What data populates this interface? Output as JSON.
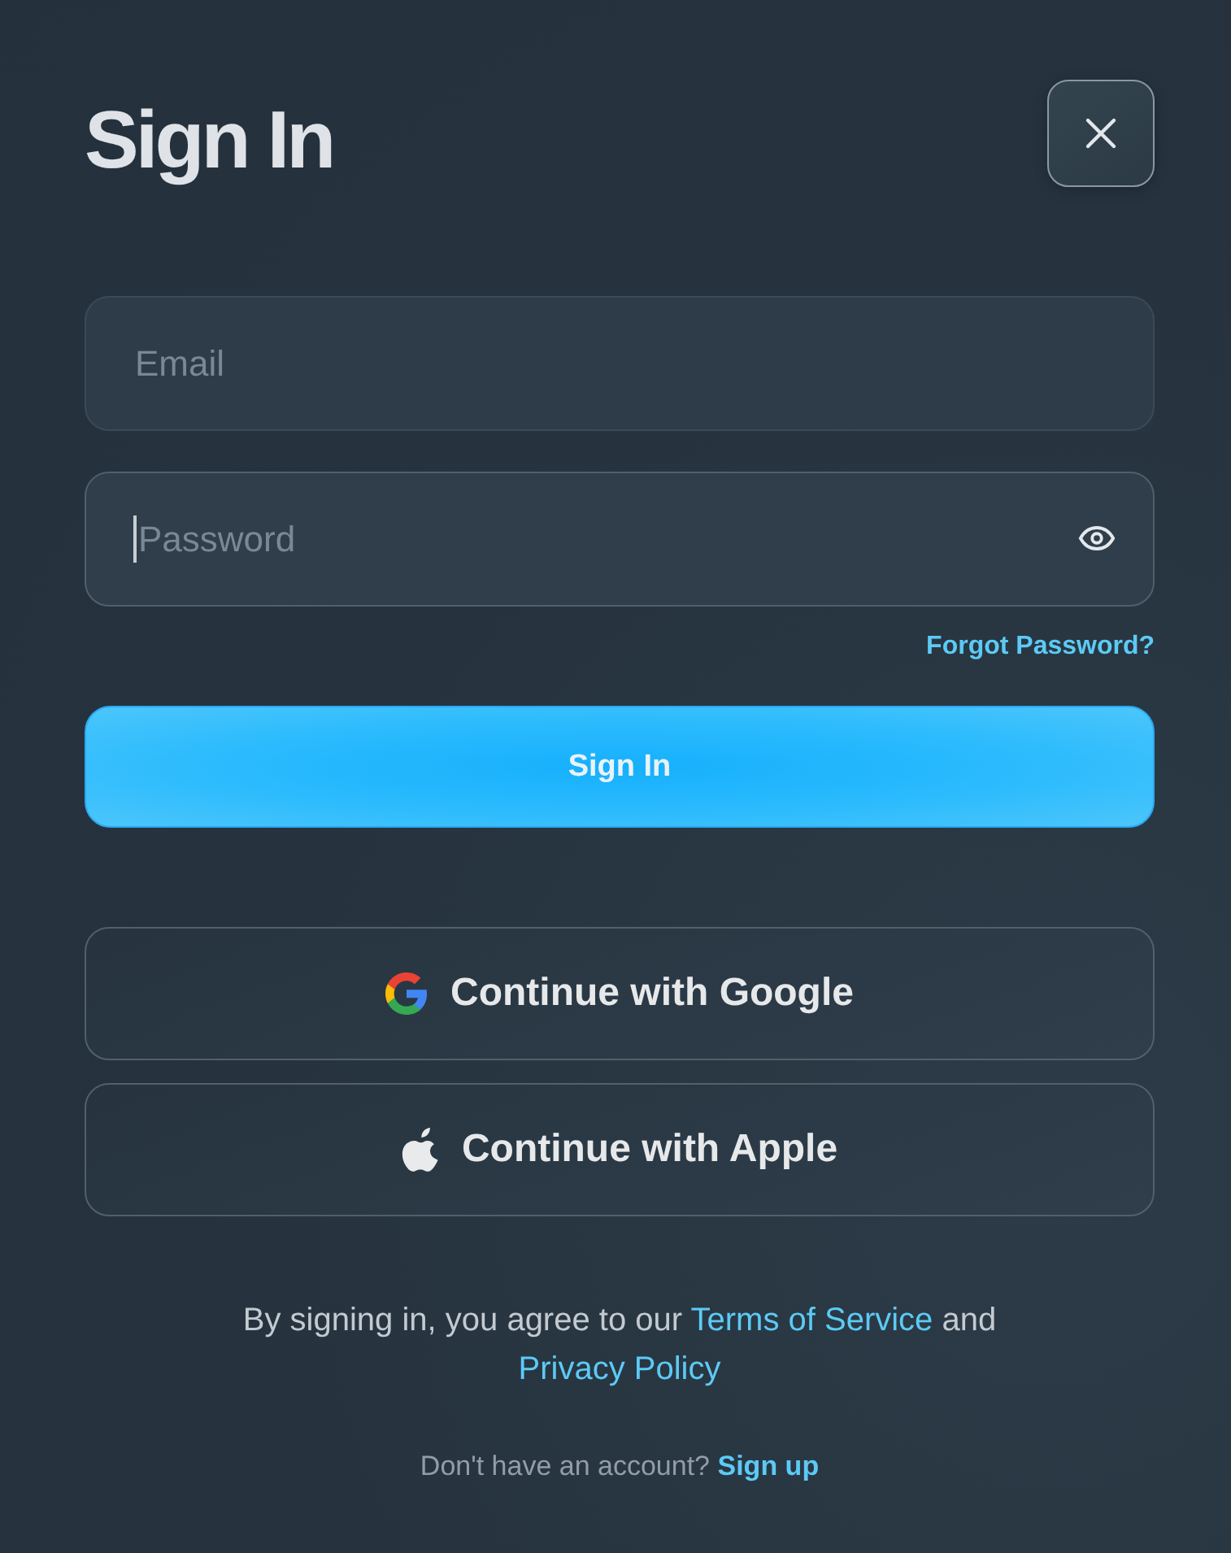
{
  "dialog": {
    "title": "Sign In"
  },
  "fields": [
    {
      "kind": "email",
      "placeholder": "Email",
      "focused": false
    },
    {
      "kind": "password",
      "placeholder": "Password",
      "focused": true
    }
  ],
  "forgot_link": "Forgot Password?",
  "submit_button": "Sign In",
  "social_buttons": [
    {
      "kind": "google",
      "label": "Continue with Google"
    },
    {
      "kind": "apple",
      "label": "Continue with Apple"
    }
  ],
  "legal": {
    "text_before": "By signing in, you agree to our ",
    "terms_link": "Terms of Service",
    "text_between": " and ",
    "privacy_link": "Privacy Policy"
  },
  "signup": {
    "prompt": "Don't have an account? ",
    "link": "Sign up"
  }
}
